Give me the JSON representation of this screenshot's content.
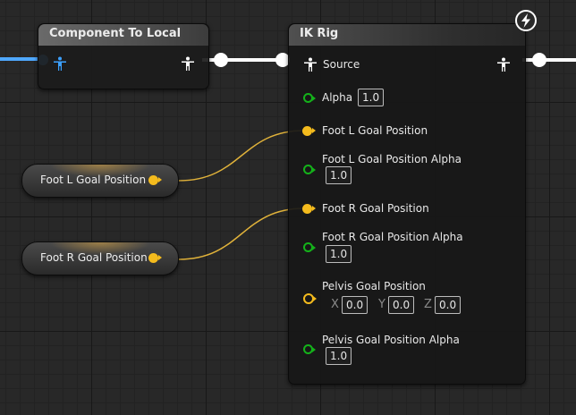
{
  "colors": {
    "exec_wire": "#ffffff",
    "pose_wire_left": "#4fa8ff",
    "vector_wire": "#e0b23a",
    "float_pin": "#14b21a",
    "vector_pin": "#f4bb1d"
  },
  "nodes": {
    "component_to_local": {
      "title": "Component To Local",
      "input_icon": "person-icon",
      "output_icon": "person-icon"
    },
    "ik_rig": {
      "title": "IK Rig",
      "badge_icon": "lightning-icon",
      "source_label": "Source",
      "alpha_label": "Alpha",
      "alpha_value": "1.0",
      "foot_l_goal_label": "Foot L Goal Position",
      "foot_l_alpha_label": "Foot L Goal Position Alpha",
      "foot_l_alpha_value": "1.0",
      "foot_r_goal_label": "Foot R Goal Position",
      "foot_r_alpha_label": "Foot R Goal Position Alpha",
      "foot_r_alpha_value": "1.0",
      "pelvis_goal_label": "Pelvis Goal Position",
      "pelvis_x_label": "X",
      "pelvis_x_value": "0.0",
      "pelvis_y_label": "Y",
      "pelvis_y_value": "0.0",
      "pelvis_z_label": "Z",
      "pelvis_z_value": "0.0",
      "pelvis_alpha_label": "Pelvis Goal Position Alpha",
      "pelvis_alpha_value": "1.0"
    },
    "foot_l_variable": {
      "label": "Foot L Goal Position"
    },
    "foot_r_variable": {
      "label": "Foot R Goal Position"
    }
  }
}
